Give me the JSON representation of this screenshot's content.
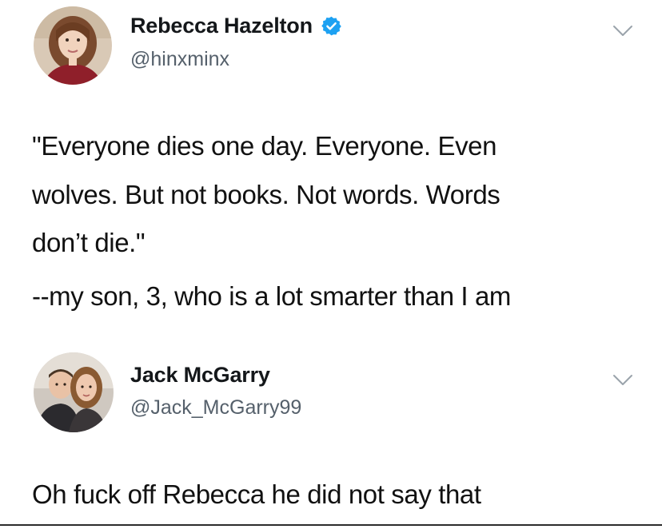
{
  "tweets": [
    {
      "display_name": "Rebecca Hazelton",
      "handle": "@hinxminx",
      "verified": true,
      "lines": [
        "\"Everyone dies one day. Everyone. Even",
        "wolves. But not books. Not words. Words",
        "don’t die.\"",
        "--my son, 3, who is a lot smarter than I am"
      ]
    },
    {
      "display_name": "Jack McGarry",
      "handle": "@Jack_McGarry99",
      "verified": false,
      "lines": [
        "Oh fuck off Rebecca he did not say that"
      ]
    }
  ],
  "colors": {
    "verified_badge": "#1da1f2",
    "handle_text": "#55606b",
    "chevron": "#9aa3ab"
  }
}
